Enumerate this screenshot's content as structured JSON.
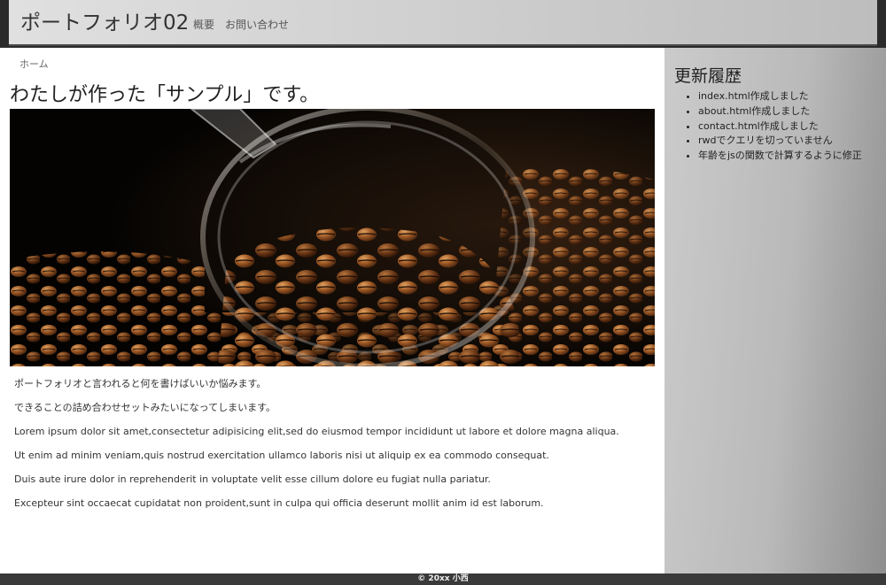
{
  "header": {
    "site_title": "ポートフォリオ02",
    "nav": [
      "概要",
      "お問い合わせ"
    ]
  },
  "breadcrumb": "ホーム",
  "main": {
    "heading": "わたしが作った「サンプル」です。",
    "hero_image": "coffee-beans-in-glass-cup",
    "paragraphs": [
      "ポートフォリオと言われると何を書けばいいか悩みます。",
      "できることの詰め合わせセットみたいになってしまいます。",
      "Lorem ipsum dolor sit amet,consectetur adipisicing elit,sed do eiusmod tempor incididunt ut labore et dolore magna aliqua.",
      "Ut enim ad minim veniam,quis nostrud exercitation ullamco laboris nisi ut aliquip ex ea commodo consequat.",
      "Duis aute irure dolor in reprehenderit in voluptate velit esse cillum dolore eu fugiat nulla pariatur.",
      "Excepteur sint occaecat cupidatat non proident,sunt in culpa qui officia deserunt mollit anim id est laborum."
    ]
  },
  "sidebar": {
    "title": "更新履歴",
    "items": [
      "index.html作成しました",
      "about.html作成しました",
      "contact.html作成しました",
      "rwdでクエリを切っていません",
      "年齢をjsの関数で計算するように修正"
    ]
  },
  "footer": {
    "text": "© 20xx 小西"
  },
  "colors": {
    "header_bg": "#cfcfcf",
    "sidebar_bg": "#b9b9b9",
    "footer_bg": "#3a3a3a"
  }
}
